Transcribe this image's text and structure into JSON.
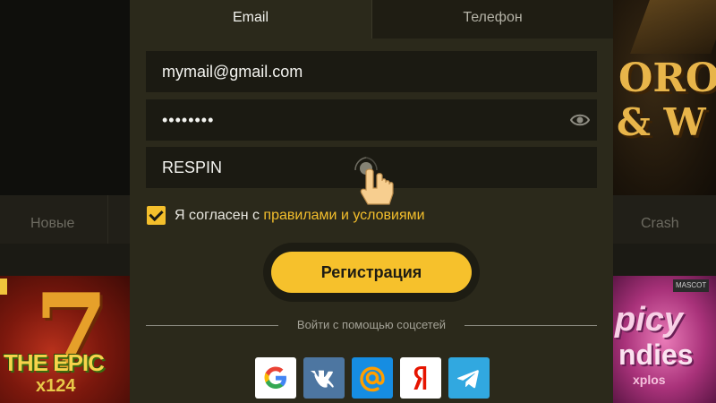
{
  "background": {
    "nav": [
      "Новые",
      "Crash"
    ],
    "tile_left": {
      "line1": "7",
      "line2": "THE EPIC",
      "line3": "x124"
    },
    "tile_right": {
      "line1": "picy",
      "line2": "ndies",
      "line3": "xplos",
      "badge": "MASCOT"
    },
    "hero_right": {
      "line1": "ORO",
      "line2": "& W"
    }
  },
  "tabs": [
    {
      "label": "Email",
      "active": true
    },
    {
      "label": "Телефон",
      "active": false
    }
  ],
  "form": {
    "email_value": "mymail@gmail.com",
    "password_value": "••••••••",
    "promo_value": "RESPIN",
    "agree_checked": true,
    "agree_text": "Я согласен с ",
    "agree_link": "правилами и условиями",
    "submit_label": "Регистрация"
  },
  "social": {
    "label": "Войти с помощью соцсетей",
    "providers": [
      "google-icon",
      "vk-icon",
      "mailru-icon",
      "yandex-icon",
      "telegram-icon"
    ]
  },
  "colors": {
    "accent": "#f6c12c",
    "modal_bg": "#2b291b",
    "field_bg": "#1b1a12"
  }
}
